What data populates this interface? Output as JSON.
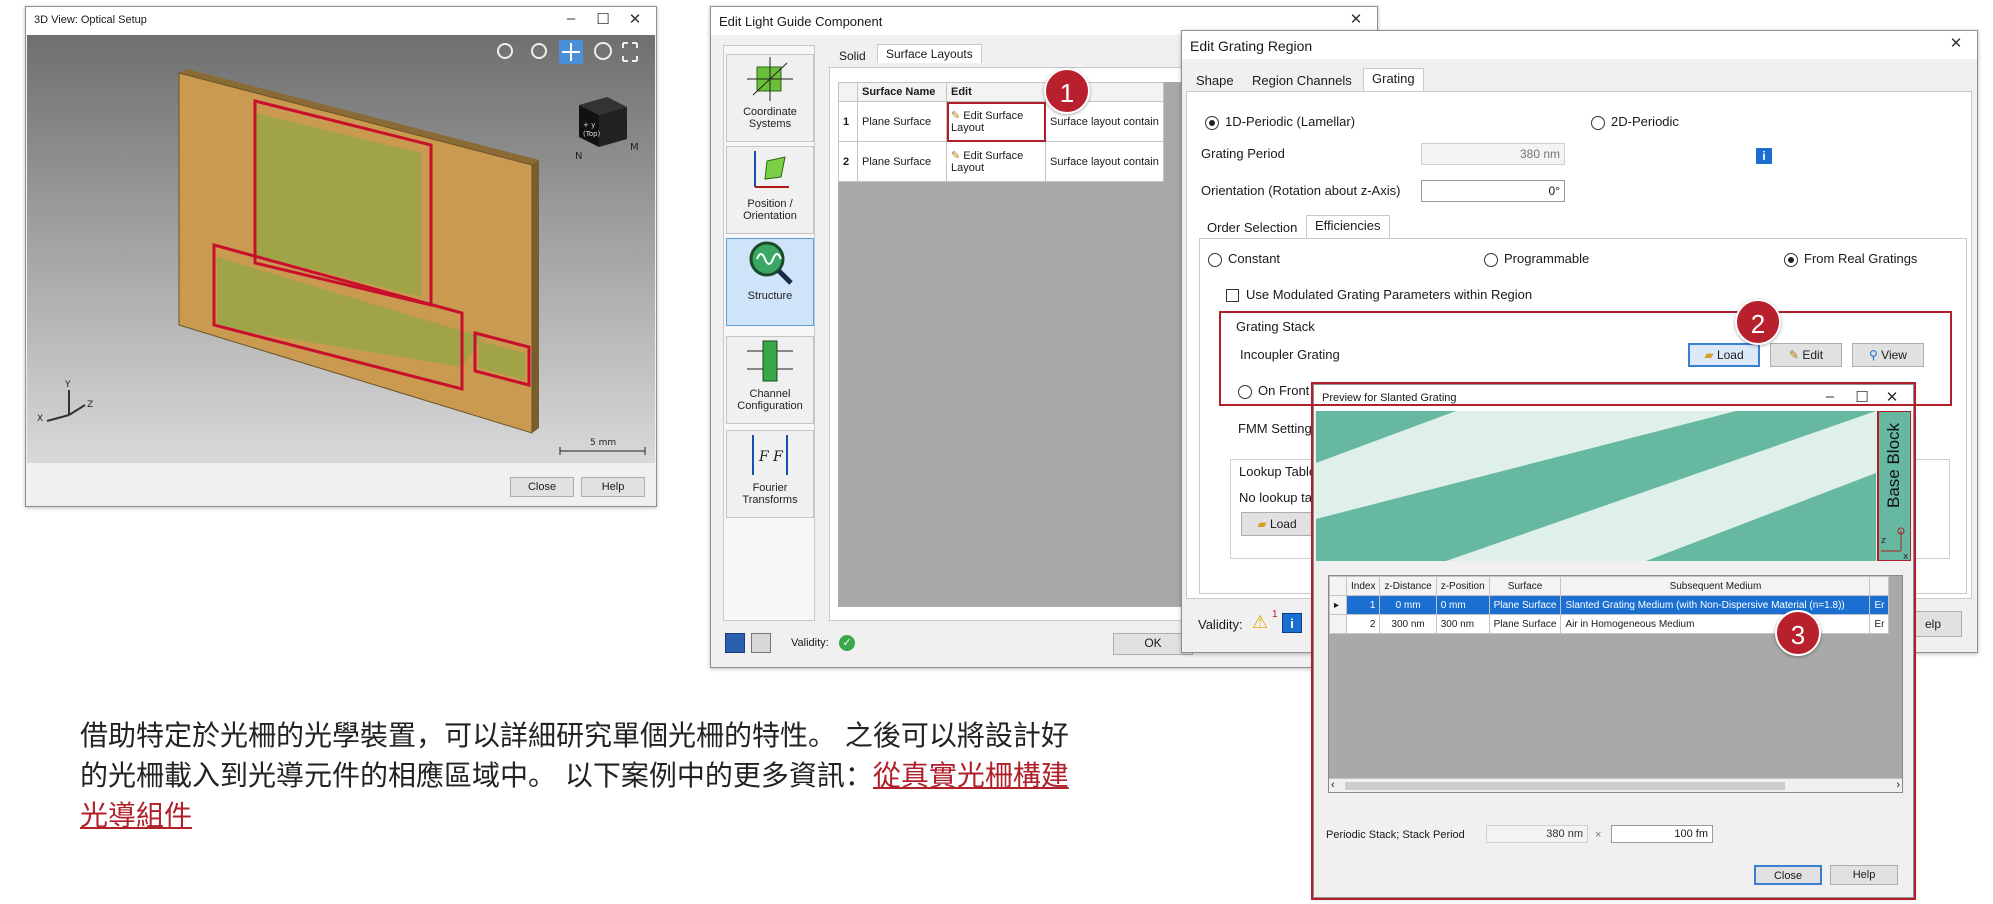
{
  "view3d": {
    "title": "3D View: Optical Setup",
    "scale_label": "5 mm",
    "axis_x": "X",
    "axis_y": "Y",
    "axis_z": "Z",
    "cube_label": "+ y\n(Top)",
    "close_label": "Close",
    "help_label": "Help",
    "colors": {
      "plate": "#c99a50",
      "highlight": "#c8102e",
      "region": "#9aa548"
    }
  },
  "light_guide": {
    "title": "Edit Light Guide Component",
    "side_items": [
      {
        "label": "Coordinate Systems",
        "icon": "coordinate-systems-icon"
      },
      {
        "label": "Position / Orientation",
        "icon": "position-orientation-icon"
      },
      {
        "label": "Structure",
        "icon": "structure-icon"
      },
      {
        "label": "Channel Configuration",
        "icon": "channel-configuration-icon"
      },
      {
        "label": "Fourier Transforms",
        "icon": "fourier-transforms-icon"
      }
    ],
    "tabs": [
      "Solid",
      "Surface Layouts"
    ],
    "table": {
      "headers": [
        "Surface Name",
        "Edit"
      ],
      "rows": [
        {
          "index": "1",
          "name": "Plane Surface",
          "edit": "Edit Surface Layout",
          "desc": "Surface layout contain"
        },
        {
          "index": "2",
          "name": "Plane Surface",
          "edit": "Edit Surface Layout",
          "desc": "Surface layout contain"
        }
      ]
    },
    "validity_label": "Validity:",
    "ok_label": "OK"
  },
  "grating_region": {
    "title": "Edit Grating Region",
    "tabs": [
      "Shape",
      "Region Channels",
      "Grating"
    ],
    "radio_1d": "1D-Periodic (Lamellar)",
    "radio_2d": "2D-Periodic",
    "period_label": "Grating Period",
    "period_value": "380 nm",
    "orientation_label": "Orientation (Rotation about z-Axis)",
    "orientation_value": "0°",
    "subtabs": [
      "Order Selection",
      "Efficiencies"
    ],
    "eff_constant": "Constant",
    "eff_programmable": "Programmable",
    "eff_real": "From Real Gratings",
    "modulated_label": "Use Modulated Grating Parameters within Region",
    "stack_group": "Grating Stack",
    "incoupler_label": "Incoupler Grating",
    "load_label": "Load",
    "edit_label": "Edit",
    "view_label": "View",
    "front_label": "On Front S",
    "fmm_label": "FMM Settings",
    "lookup_group": "Lookup Table",
    "lookup_text": "No lookup ta",
    "lookup_load": "Load",
    "validity_label": "Validity:",
    "validity_count": "1",
    "help_partial": "elp"
  },
  "preview": {
    "title": "Preview for Slanted Grating",
    "base_block": "Base Block",
    "axis_z": "z",
    "axis_x": "x",
    "headers": [
      "Index",
      "z-Distance",
      "z-Position",
      "Surface",
      "Subsequent Medium"
    ],
    "rows": [
      {
        "index": "1",
        "z_distance": "0 mm",
        "z_position": "0 mm",
        "surface": "Plane Surface",
        "medium": "Slanted Grating Medium (with Non-Dispersive Material (n=1.8))",
        "tail": "Er"
      },
      {
        "index": "2",
        "z_distance": "300 nm",
        "z_position": "300 nm",
        "surface": "Plane Surface",
        "medium": "Air in Homogeneous Medium",
        "tail": "Er"
      }
    ],
    "footer_label": "Periodic Stack; Stack Period",
    "period_a": "380 nm",
    "times": "×",
    "period_b": "100 fm",
    "close_label": "Close",
    "help_label": "Help",
    "colors": {
      "grating": "#66b8a0",
      "light": "#dff0ea",
      "selected": "#1a6fd0"
    }
  },
  "badges": [
    "1",
    "2",
    "3"
  ],
  "description": {
    "text": "借助特定於光柵的光學裝置，可以詳細研究單個光柵的特性。 之後可以將設計好的光柵載入到光導元件的相應區域中。 以下案例中的更多資訊：",
    "link": "從真實光柵構建光導組件"
  }
}
